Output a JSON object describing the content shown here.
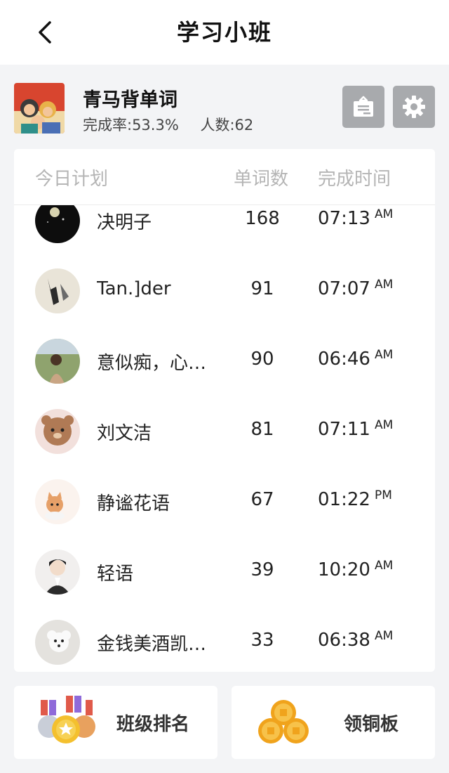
{
  "header": {
    "title": "学习小班",
    "back_icon": "chevron-left-icon"
  },
  "group": {
    "name": "青马背单词",
    "completion": "完成率:53.3%",
    "members": "人数:62",
    "board_icon": "board-icon",
    "settings_icon": "gear-icon"
  },
  "table": {
    "headers": {
      "plan": "今日计划",
      "words": "单词数",
      "time": "完成时间"
    },
    "rows": [
      {
        "name": "决明子",
        "words": "168",
        "time": "07:13",
        "ampm": "AM"
      },
      {
        "name": "Tan.]der",
        "words": "91",
        "time": "07:07",
        "ampm": "AM"
      },
      {
        "name": "意似痴，心…",
        "words": "90",
        "time": "06:46",
        "ampm": "AM"
      },
      {
        "name": "刘文洁",
        "words": "81",
        "time": "07:11",
        "ampm": "AM"
      },
      {
        "name": "静谧花语",
        "words": "67",
        "time": "01:22",
        "ampm": "PM"
      },
      {
        "name": "轻语",
        "words": "39",
        "time": "10:20",
        "ampm": "AM"
      },
      {
        "name": "金钱美酒凯…",
        "words": "33",
        "time": "06:38",
        "ampm": "AM"
      }
    ]
  },
  "actions": {
    "ranking": {
      "label": "班级排名",
      "icon": "medals-icon"
    },
    "coins": {
      "label": "领铜板",
      "icon": "coins-icon"
    }
  },
  "colors": {
    "icon_button_bg": "#a8aaad",
    "coin": "#f5a623",
    "medal_red": "#e05a4a"
  }
}
